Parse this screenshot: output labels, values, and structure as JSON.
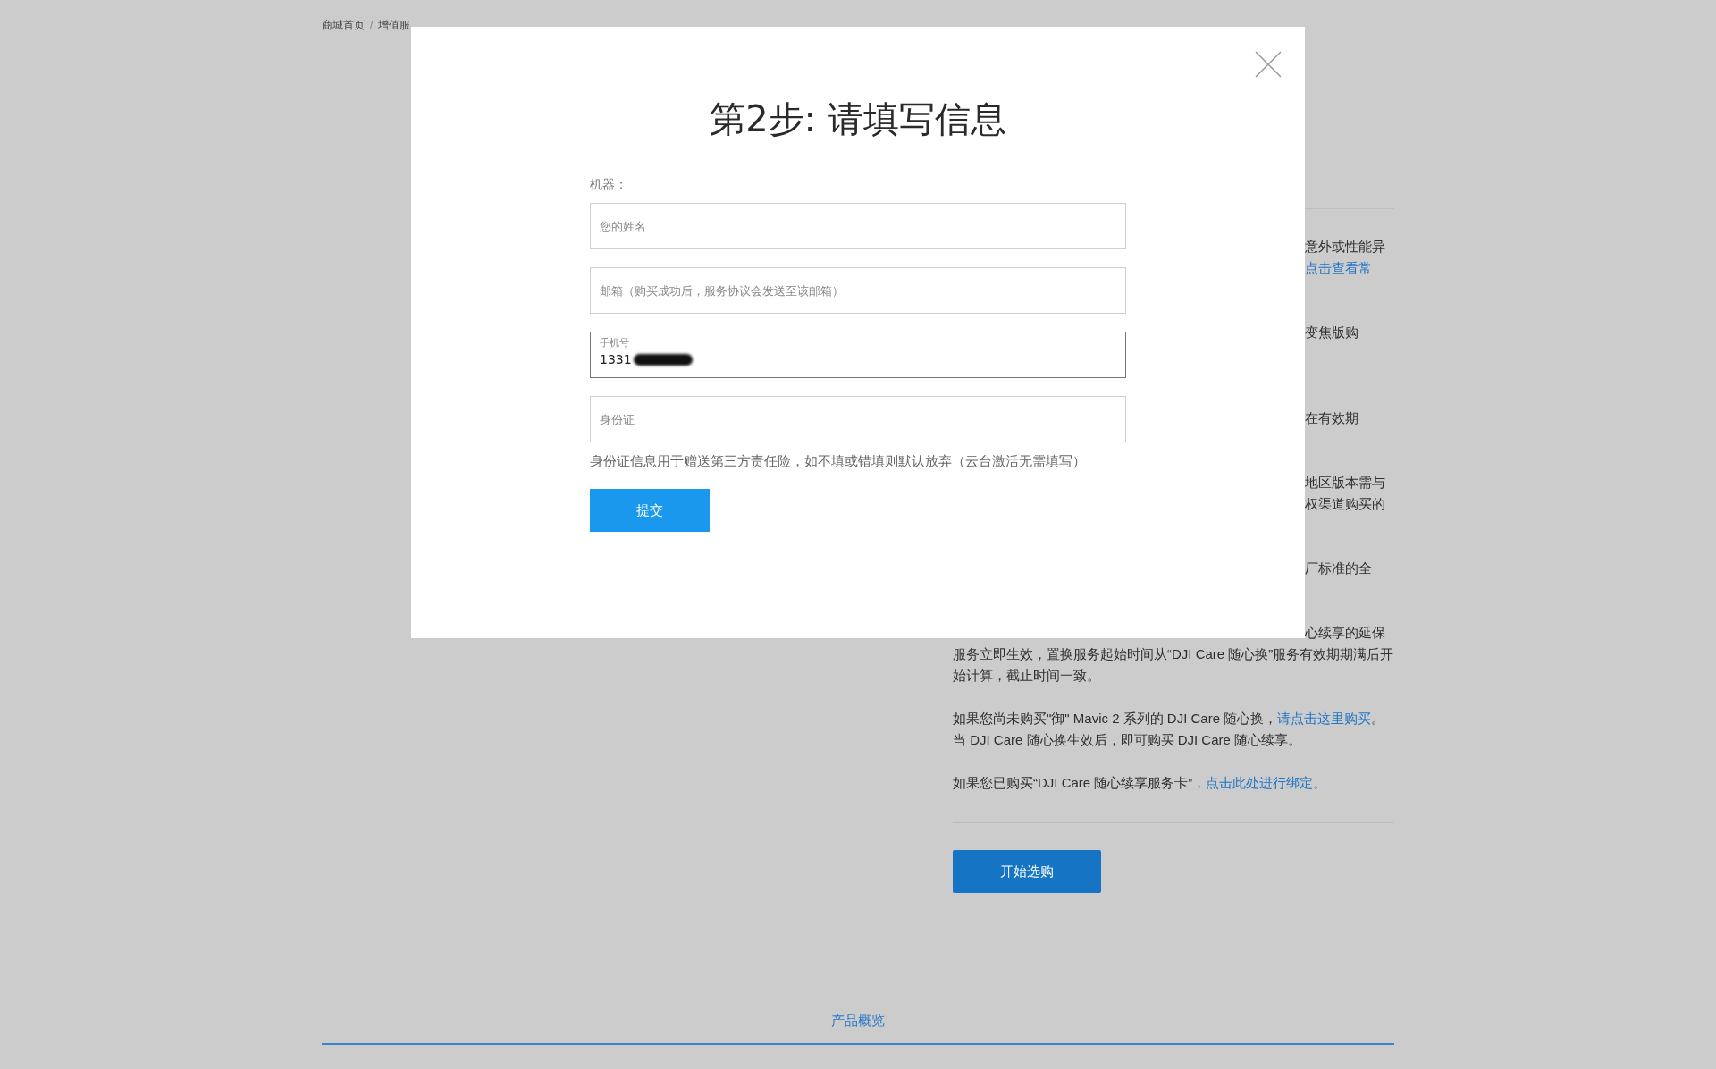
{
  "breadcrumb": {
    "items": [
      "商城首页",
      "增值服"
    ],
    "separator": "/"
  },
  "fragments": [
    {
      "lines": [
        {
          "text": "意外或性能异",
          "link": false
        },
        {
          "text": "点击查看常",
          "link": true
        }
      ]
    },
    {
      "lines": [
        {
          "text": "变焦版购",
          "link": false
        }
      ]
    },
    {
      "lines": [
        {
          "text": "在有效期",
          "link": false
        }
      ]
    },
    {
      "lines": [
        {
          "text": "地区版本需与",
          "link": false
        },
        {
          "text": "权渠道购买的",
          "link": false
        }
      ]
    },
    {
      "lines": [
        {
          "text": "厂标准的全",
          "link": false
        }
      ]
    },
    {
      "lines": [
        {
          "text": "心续享的延保",
          "link": false
        }
      ]
    }
  ],
  "paragraphs": [
    {
      "text": "服务立即生效，置换服务起始时间从“DJI Care 随心换”服务有效期期满后开始计算，截止时间一致。"
    },
    {
      "text": "如果您尚未购买\"御\" Mavic 2 系列的 DJI Care 随心换，",
      "link": "请点击这里购买",
      "after": "。当 DJI Care 随心换生效后，即可购买 DJI Care 随心续享。"
    },
    {
      "text": "如果您已购买“DJI Care 随心续享服务卡”，",
      "link": "点击此处进行绑定。"
    }
  ],
  "buy_button": "开始选购",
  "footer_link": "产品概览",
  "modal": {
    "title": "第2步: 请填写信息",
    "label": "机器：",
    "fields": [
      {
        "placeholder": "您的姓名",
        "focused": false
      },
      {
        "placeholder": "邮箱（购买成功后，服务协议会发送至该邮箱）",
        "focused": false
      },
      {
        "label": "手机号",
        "value": "1331",
        "redacted": true,
        "focused": true
      },
      {
        "placeholder": "身份证",
        "focused": false
      }
    ],
    "hint": "身份证信息用于赠送第三方责任险，如不填或错填则默认放弃（云台激活无需填写）",
    "submit": "提交"
  }
}
